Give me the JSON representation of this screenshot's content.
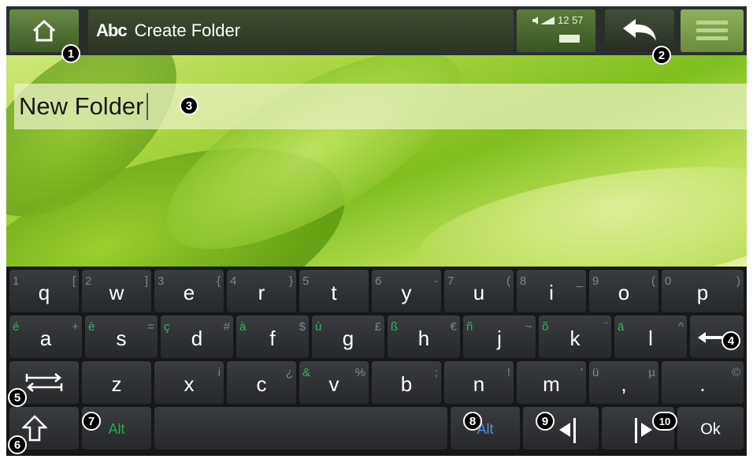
{
  "topbar": {
    "title": "Create Folder",
    "abc_label": "Abc",
    "time": "12 57"
  },
  "text_input": {
    "value": "New Folder"
  },
  "keyboard": {
    "row1": [
      {
        "alt_left": "1",
        "main": "q",
        "alt_right": "["
      },
      {
        "alt_left": "2",
        "main": "w",
        "alt_right": "]"
      },
      {
        "alt_left": "3",
        "main": "e",
        "alt_right": "{"
      },
      {
        "alt_left": "4",
        "main": "r",
        "alt_right": "}"
      },
      {
        "alt_left": "5",
        "main": "t",
        "alt_right": ""
      },
      {
        "alt_left": "6",
        "main": "y",
        "alt_right": "-"
      },
      {
        "alt_left": "7",
        "main": "u",
        "alt_right": "("
      },
      {
        "alt_left": "8",
        "main": "i",
        "alt_right": "_"
      },
      {
        "alt_left": "9",
        "main": "o",
        "alt_right": "("
      },
      {
        "alt_left": "0",
        "main": "p",
        "alt_right": ")"
      }
    ],
    "row2": [
      {
        "alt_left": "é",
        "main": "a",
        "alt_right": "+"
      },
      {
        "alt_left": "è",
        "main": "s",
        "alt_right": "="
      },
      {
        "alt_left": "ç",
        "main": "d",
        "alt_right": "#"
      },
      {
        "alt_left": "à",
        "main": "f",
        "alt_right": "$"
      },
      {
        "alt_left": "ù",
        "main": "g",
        "alt_right": "£"
      },
      {
        "alt_left": "ß",
        "main": "h",
        "alt_right": "€"
      },
      {
        "alt_left": "ñ",
        "main": "j",
        "alt_right": "~"
      },
      {
        "alt_left": "õ",
        "main": "k",
        "alt_right": "¨"
      },
      {
        "alt_left": "ä",
        "main": "l",
        "alt_right": "^"
      }
    ],
    "row3": [
      {
        "alt_left": "",
        "main": "z",
        "alt_right": ""
      },
      {
        "alt_left": "",
        "main": "x",
        "alt_right": "i"
      },
      {
        "alt_left": "",
        "main": "c",
        "alt_right": "¿"
      },
      {
        "alt_left": "&",
        "main": "v",
        "alt_right": "%"
      },
      {
        "alt_left": "",
        "main": "b",
        "alt_right": ";"
      },
      {
        "alt_left": "",
        "main": "n",
        "alt_right": "!"
      },
      {
        "alt_left": "",
        "main": "m",
        "alt_right": "'"
      },
      {
        "alt_left": "ü",
        "main": ",",
        "alt_right": "µ"
      },
      {
        "alt_left": "",
        "main": ".",
        "alt_right": "©"
      }
    ],
    "alt_left_label": "Alt",
    "alt_right_label": "Alt",
    "ok_label": "Ok"
  },
  "callouts": [
    "1",
    "2",
    "3",
    "4",
    "5",
    "6",
    "7",
    "8",
    "9",
    "10"
  ],
  "colors": {
    "alt_left_green": "#2aa84e",
    "alt_right_blue": "#4c8fe0",
    "accent_green": "#6b8a45"
  }
}
